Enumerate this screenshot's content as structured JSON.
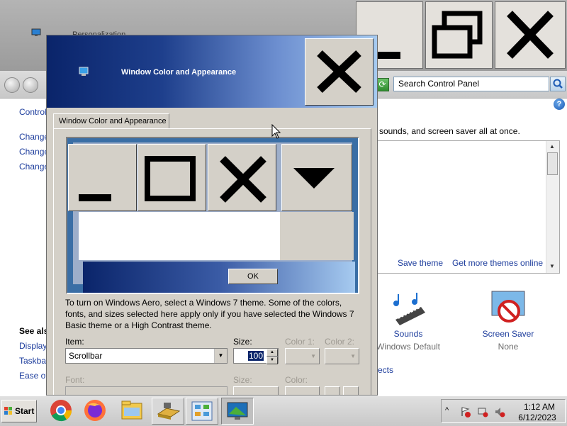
{
  "background_window": {
    "title": "Personalization",
    "search_placeholder": "Search Control Panel",
    "left_links": [
      "Control",
      "Change",
      "Change",
      "Change"
    ],
    "see_also_label": "See als",
    "see_also_links": [
      "Display",
      "Taskbar",
      "Ease of"
    ],
    "description": "sounds, and screen saver all at once.",
    "theme_links": {
      "save": "Save theme",
      "more": "Get more themes online"
    },
    "effects_link": "ects",
    "tiles": [
      {
        "name": "Sounds",
        "value": "Windows Default"
      },
      {
        "name": "Screen Saver",
        "value": "None"
      }
    ]
  },
  "dialog": {
    "title": "Window Color and Appearance",
    "tab_label": "Window Color and Appearance",
    "preview_ok_label": "OK",
    "info_text": "To turn on Windows Aero, select a Windows 7 theme.  Some of the colors, fonts, and sizes selected here apply only if you have selected the Windows 7 Basic theme or a High Contrast theme.",
    "labels": {
      "item": "Item:",
      "size": "Size:",
      "color1": "Color 1:",
      "color2": "Color 2:",
      "font": "Font:",
      "font_size": "Size:",
      "font_color": "Color:"
    },
    "item_value": "Scrollbar",
    "size_value": "100"
  },
  "taskbar": {
    "start_label": "Start",
    "apps": [
      "chrome-icon",
      "firefox-icon",
      "file-explorer-icon",
      "drive-icon",
      "control-panel-icon",
      "personalization-icon"
    ],
    "time": "1:12 AM",
    "date": "6/12/2023"
  },
  "colors": {
    "dialog_face": "#d4d0c8",
    "title_gradient_start": "#0a246a",
    "title_gradient_end": "#a6caf0",
    "link": "#1c3c9c",
    "selection": "#0a246a"
  }
}
